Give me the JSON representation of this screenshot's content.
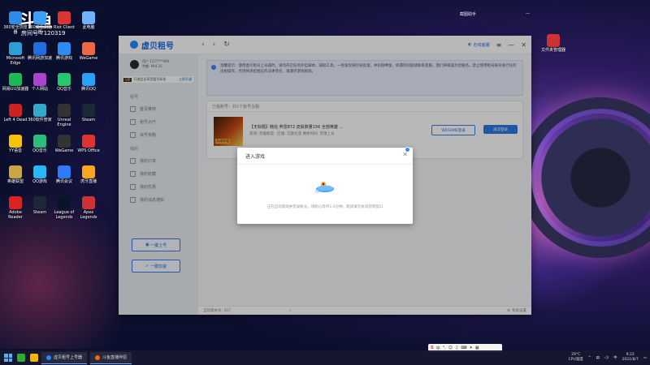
{
  "watermark": {
    "logo": "斗鱼",
    "room": "房间号",
    "room_no": "7120319"
  },
  "desktop_icons": [
    {
      "label": "360安全浏览器",
      "color": "#2f8be6"
    },
    {
      "label": "360安全浏览器",
      "color": "#3aa0ff"
    },
    {
      "label": "Riot Client",
      "color": "#d33"
    },
    {
      "label": "此电脑",
      "color": "#6fb3ff"
    },
    {
      "label": "Microsoft Edge",
      "color": "#2c9fd6"
    },
    {
      "label": "腾讯网游加速",
      "color": "#1f6fe0"
    },
    {
      "label": "腾讯游戏",
      "color": "#2d8cf0"
    },
    {
      "label": "WeGame",
      "color": "#e64"
    },
    {
      "label": "网易UU加速器",
      "color": "#1db954"
    },
    {
      "label": "个人网站",
      "color": "#a4c"
    },
    {
      "label": "QQ音乐",
      "color": "#28c76f"
    },
    {
      "label": "腾讯QQ",
      "color": "#27a2f8"
    },
    {
      "label": "Left 4 Dead",
      "color": "#c22"
    },
    {
      "label": "360软件管家",
      "color": "#3ac"
    },
    {
      "label": "Unreal Engine",
      "color": "#333"
    },
    {
      "label": "Steam",
      "color": "#1b2838"
    },
    {
      "label": "YY语音",
      "color": "#f6c20a"
    },
    {
      "label": "QQ音乐",
      "color": "#2bbd7e"
    },
    {
      "label": "WeGame",
      "color": "#333"
    },
    {
      "label": "WPS Office",
      "color": "#d33"
    },
    {
      "label": "英雄联盟",
      "color": "#c9a646"
    },
    {
      "label": "QQ游戏",
      "color": "#29b6f6"
    },
    {
      "label": "腾讯会议",
      "color": "#2d7cf6"
    },
    {
      "label": "虎牙直播",
      "color": "#f6a623"
    },
    {
      "label": "Adobe Reader",
      "color": "#d22"
    },
    {
      "label": "Steam",
      "color": "#1b2838"
    },
    {
      "label": "League of Legends",
      "color": "#0a1428"
    },
    {
      "label": "Apex Legends",
      "color": "#c33"
    }
  ],
  "top_right_widget": {
    "label": "截图助手",
    "btn": "—"
  },
  "right_desktop_icon": {
    "label": "文件夹管理器"
  },
  "app": {
    "title": "虚贝租号",
    "nav_back": "‹",
    "nav_forward": "›",
    "nav_refresh": "↻",
    "online_service": "在线客服",
    "menu_icon": "≡",
    "minimize": "—",
    "close": "✕"
  },
  "sidebar": {
    "username": "用户 1377***969",
    "balance": "余额: ¥44.31",
    "vip_tag": "VIP",
    "vip_text": "开通会员享受租号折扣",
    "vip_link": "立即开通",
    "section_rent": "租号",
    "rent_items": [
      "首页推荐",
      "租号大厅",
      "找号攻略"
    ],
    "section_mine": "我的",
    "mine_items": [
      "我的订单",
      "我的收藏",
      "我的优惠",
      "我的消息通知"
    ],
    "btn_quick_rent": "一键上号",
    "btn_quick_accelerate": "一键加速"
  },
  "notice": {
    "icon": "i",
    "text": "温馨提示：使用虚贝租号上号器时，请勿开启任何外挂脚本、辅助工具，一经发现将封号处理，并扣除押金。如遇到问题请联系客服，我们将竭诚为您服务。禁止使用租号账号进行任何违规操作，否则将承担相应的法律责任，请遵守游戏规则。"
  },
  "list": {
    "header": "已租账号：共1个账号在租",
    "thumb_label": "英雄联盟",
    "account_title": "【无标题】韩信 奔雷872 皮肤数量156 全部英雄 …",
    "account_sub": "游戏: 英雄联盟 · 区服: 艾欧尼亚   剩余时间: 无限上号",
    "btn_outline": "WEGAME登录",
    "btn_solid": "再次登录"
  },
  "statusbar": {
    "version": "当前版本号: 167",
    "settings": "系统设置"
  },
  "modal": {
    "title": "进入游戏",
    "close": "✕",
    "message": "正在启动游戏并登录账号，请耐心等待1-2分钟，期间请勿关闭游戏窗口"
  },
  "taskbar": {
    "task1": "虚贝租号上号器",
    "task2": "斗鱼直播伴侣",
    "weather_temp": "29°C",
    "weather_desc": "CPU温度",
    "ime": "中",
    "time": "9:23",
    "date": "2021/8/7"
  }
}
